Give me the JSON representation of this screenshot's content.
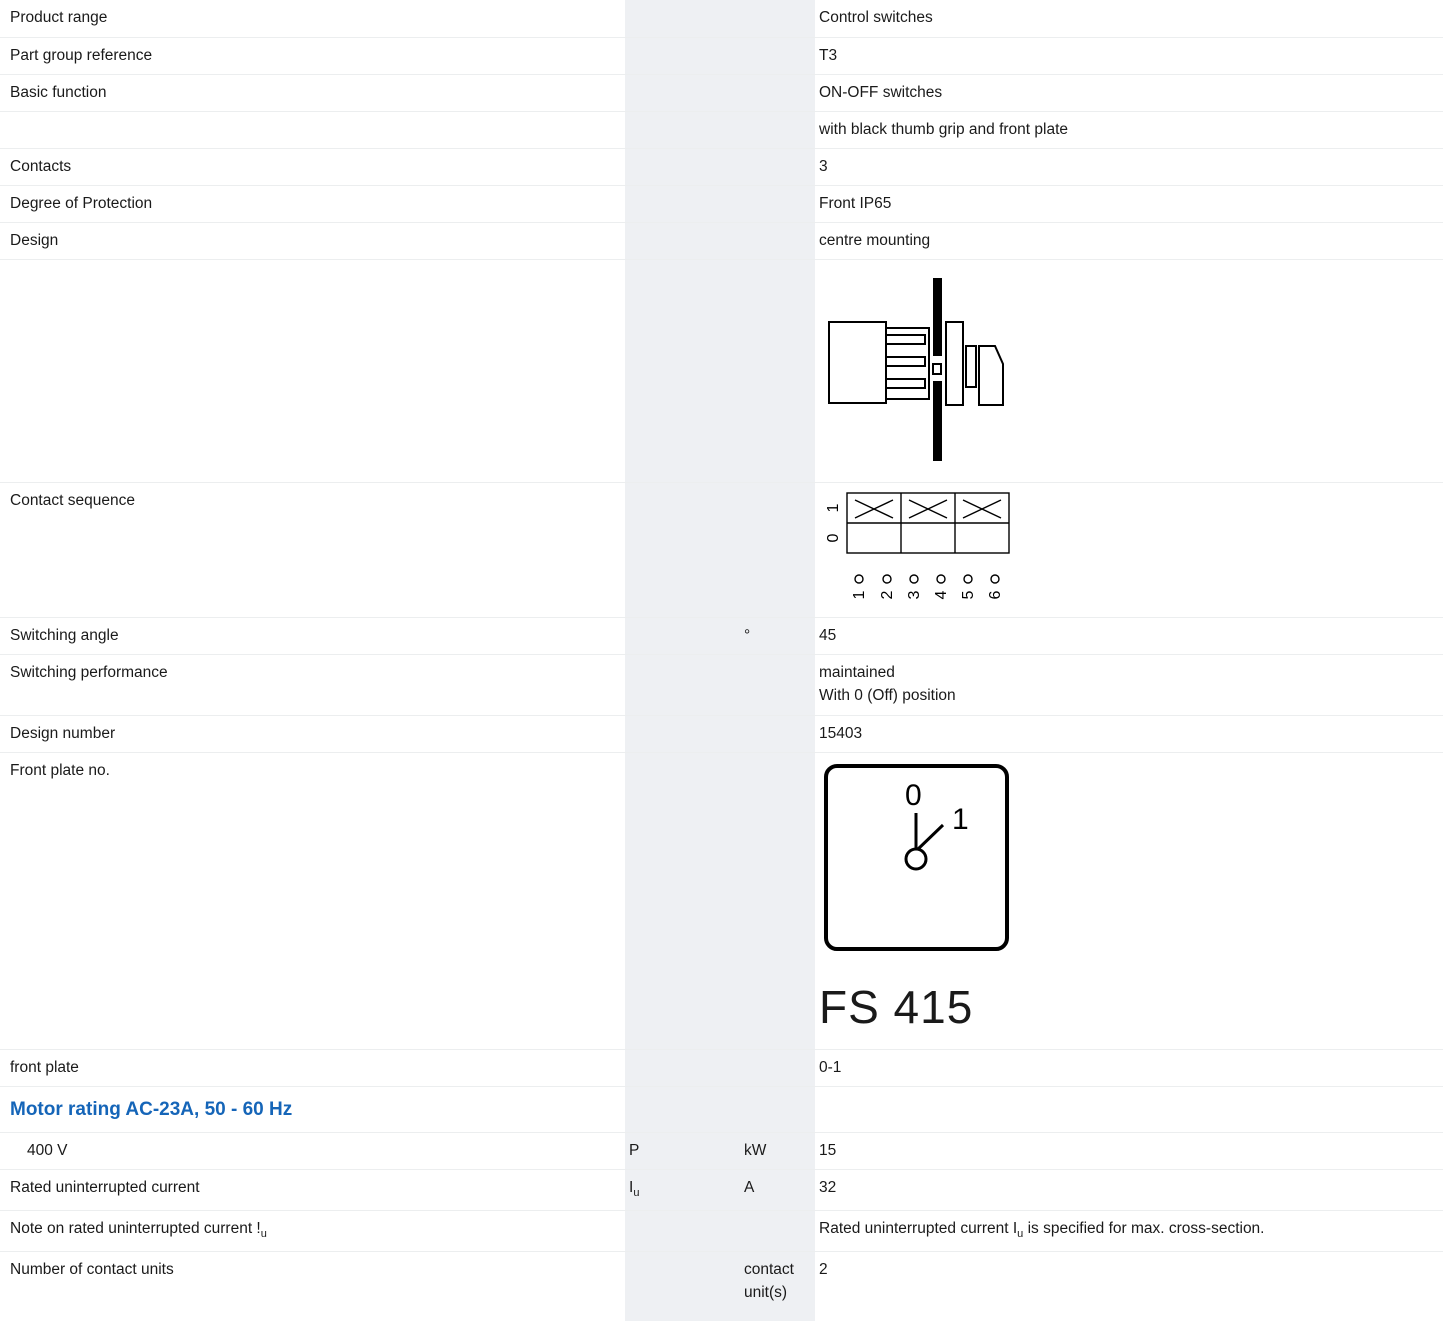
{
  "rows": {
    "product_range": {
      "label": "Product range",
      "value": "Control switches"
    },
    "part_group": {
      "label": "Part group reference",
      "value": "T3"
    },
    "basic_function": {
      "label": "Basic function",
      "value": "ON-OFF switches"
    },
    "basic_function_extra": {
      "value": "with black thumb grip and front plate"
    },
    "contacts": {
      "label": "Contacts",
      "value": "3"
    },
    "protection": {
      "label": "Degree of Protection",
      "value": "Front IP65"
    },
    "design": {
      "label": "Design",
      "value": "centre mounting"
    },
    "contact_sequence": {
      "label": "Contact sequence",
      "positions": [
        "1",
        "0"
      ],
      "terminals": [
        "1",
        "2",
        "3",
        "4",
        "5",
        "6"
      ]
    },
    "switching_angle": {
      "label": "Switching angle",
      "unit": "°",
      "value": "45"
    },
    "switching_performance": {
      "label": "Switching performance",
      "value_line1": "maintained",
      "value_line2": "With 0 (Off) position"
    },
    "design_number": {
      "label": "Design number",
      "value": "15403"
    },
    "front_plate_no": {
      "label": "Front plate no.",
      "pos0": "0",
      "pos1": "1",
      "code": "FS 415"
    },
    "front_plate": {
      "label": "front plate",
      "value": "0-1"
    },
    "motor_heading": {
      "label": "Motor rating AC-23A, 50 - 60 Hz"
    },
    "v400": {
      "label": "400 V",
      "symbol": "P",
      "unit": "kW",
      "value": "15"
    },
    "rated_current": {
      "label": "Rated uninterrupted current",
      "symbol_main": "I",
      "symbol_sub": "u",
      "unit": "A",
      "value": "32"
    },
    "note_current": {
      "label_main": "Note on rated uninterrupted current !",
      "label_sub": "u",
      "value_pre": "Rated uninterrupted current I",
      "value_sub": "u",
      "value_post": " is specified for max. cross-section."
    },
    "contact_units": {
      "label": "Number of contact units",
      "unit_line1": "contact",
      "unit_line2": "unit(s)",
      "value": "2"
    }
  }
}
